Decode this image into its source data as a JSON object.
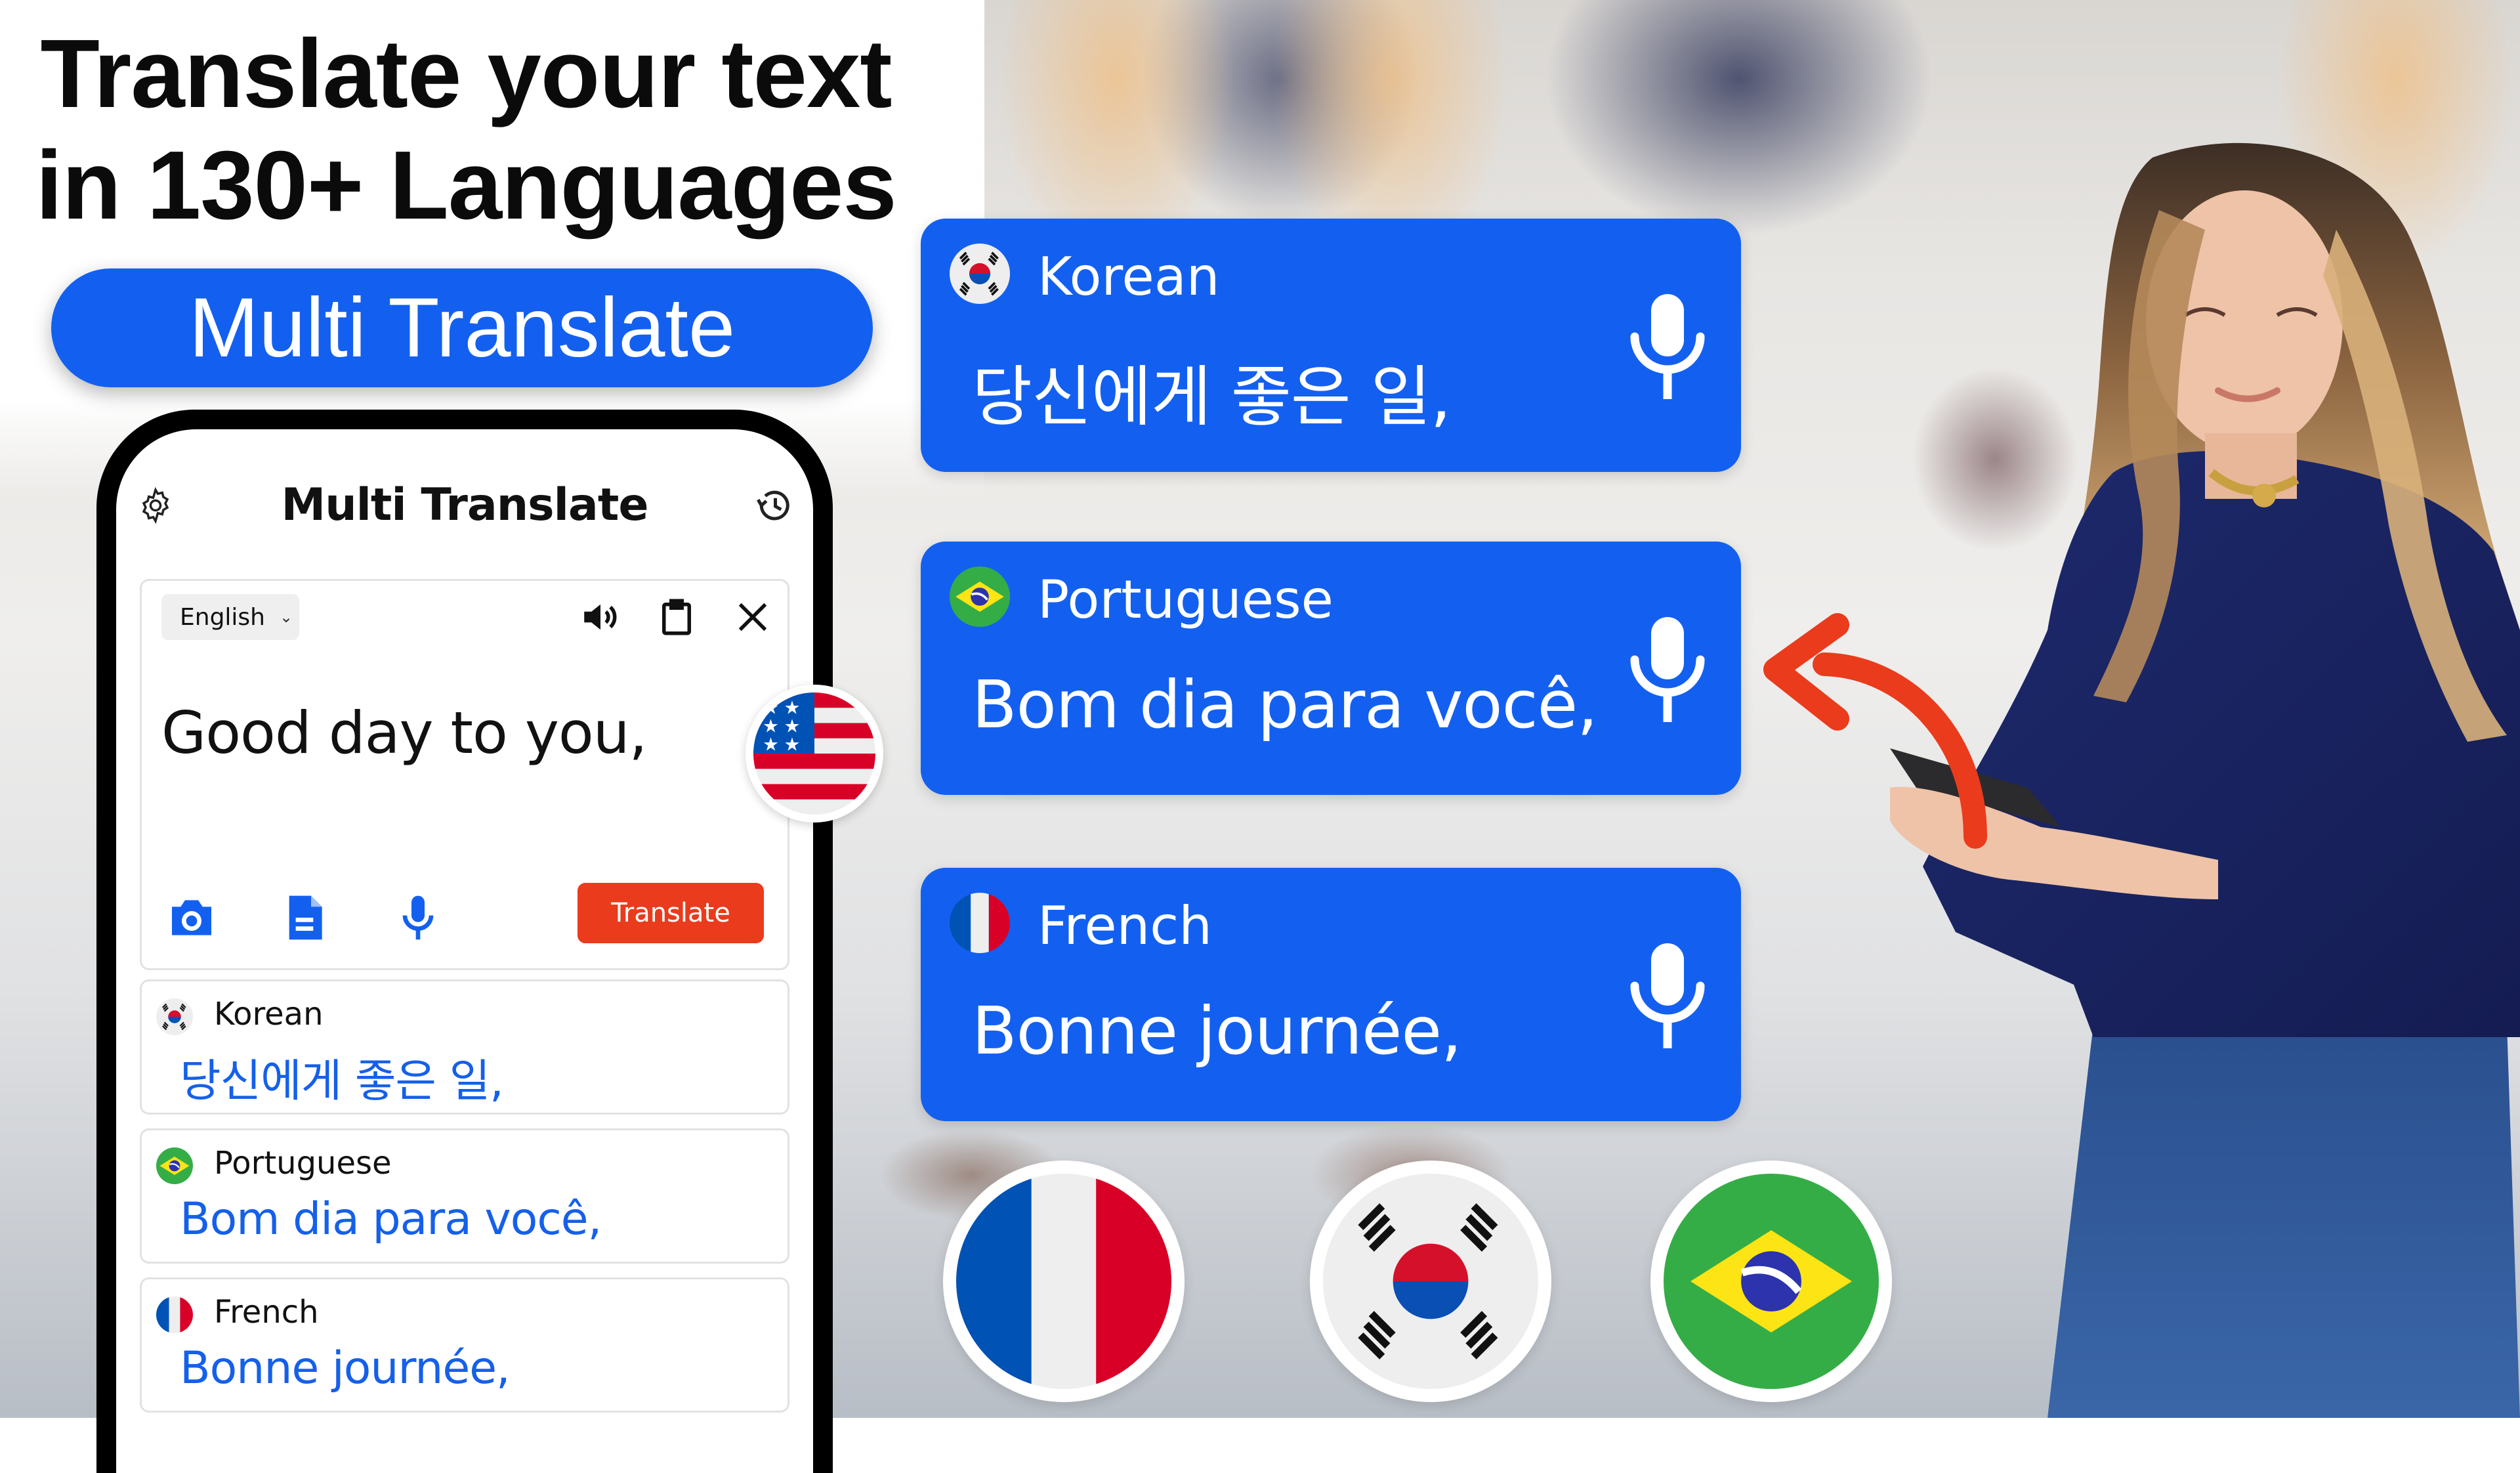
{
  "headline": {
    "line1": "Translate your text",
    "line2": "in 130+ Languages"
  },
  "badge": {
    "label": "Multi Translate"
  },
  "colors": {
    "brand_blue": "#1360f0",
    "accent_red": "#ea3b1c",
    "text_blue": "#1560ea"
  },
  "phone": {
    "app_title": "Multi Translate",
    "icons": {
      "settings": "settings-gear-icon",
      "history": "history-clock-icon"
    },
    "input": {
      "source_language": "English",
      "text": "Good day to you,",
      "actions": [
        "speaker-icon",
        "clipboard-icon",
        "close-icon"
      ],
      "tools": [
        "camera-icon",
        "document-icon",
        "microphone-icon"
      ],
      "translate_label": "Translate"
    },
    "results": [
      {
        "language": "Korean",
        "text": "당신에게 좋은 일,",
        "flag": "south-korea-flag"
      },
      {
        "language": "Portuguese",
        "text": "Bom dia para você,",
        "flag": "brazil-flag"
      },
      {
        "language": "French",
        "text": "Bonne journée,",
        "flag": "france-flag"
      }
    ]
  },
  "source_flag": "usa-flag",
  "translation_cards": [
    {
      "language": "Korean",
      "text": "당신에게 좋은 일,",
      "flag": "south-korea-flag",
      "action": "microphone-icon"
    },
    {
      "language": "Portuguese",
      "text": "Bom dia para você,",
      "flag": "brazil-flag",
      "action": "microphone-icon"
    },
    {
      "language": "French",
      "text": "Bonne journée,",
      "flag": "france-flag",
      "action": "microphone-icon"
    }
  ],
  "bottom_flags": [
    "france-flag",
    "south-korea-flag",
    "brazil-flag"
  ]
}
